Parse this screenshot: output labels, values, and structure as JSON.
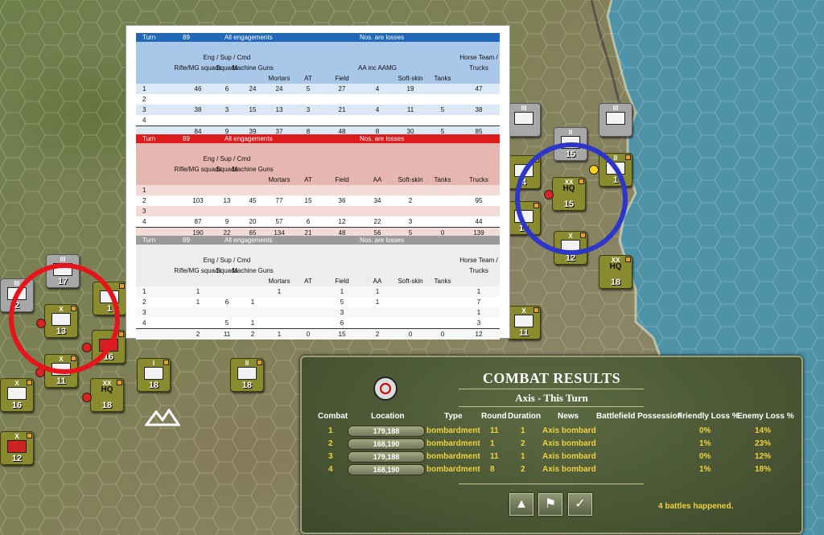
{
  "loss_tables": [
    {
      "id": "t1",
      "header": {
        "turn_label": "Turn",
        "turn": "89",
        "scope": "All engagements",
        "note": "Nos. are losses"
      },
      "columns": [
        "Rifle/MG squads",
        "Eng / Sup / Cmd Squads",
        "Machine Guns",
        "Mortars",
        "AT",
        "Field",
        "AA inc AAMG",
        "Soft-skin",
        "Tanks",
        "Horse Team / Trucks"
      ],
      "rows": [
        [
          "1",
          "46",
          "6",
          "24",
          "24",
          "5",
          "27",
          "4",
          "19",
          "",
          "47"
        ],
        [
          "2",
          "",
          "",
          "",
          "",
          "",
          "",
          "",
          "",
          "",
          ""
        ],
        [
          "3",
          "38",
          "3",
          "15",
          "13",
          "3",
          "21",
          "4",
          "11",
          "5",
          "38"
        ],
        [
          "4",
          "",
          "",
          "",
          "",
          "",
          "",
          "",
          "",
          "",
          ""
        ],
        [
          "",
          "84",
          "9",
          "39",
          "37",
          "8",
          "48",
          "8",
          "30",
          "5",
          "85"
        ]
      ]
    },
    {
      "id": "t2",
      "header": {
        "turn_label": "Turn",
        "turn": "89",
        "scope": "All engagements",
        "note": "Nos. are losses"
      },
      "columns": [
        "Rifle/MG squads",
        "Eng / Sup / Cmd Squads",
        "Machine Guns",
        "Mortars",
        "AT",
        "Field",
        "AA",
        "Soft-skin",
        "Tanks",
        "Trucks"
      ],
      "rows": [
        [
          "1",
          "",
          "",
          "",
          "",
          "",
          "",
          "",
          "",
          "",
          ""
        ],
        [
          "2",
          "103",
          "13",
          "45",
          "77",
          "15",
          "36",
          "34",
          "2",
          "",
          "95"
        ],
        [
          "3",
          "",
          "",
          "",
          "",
          "",
          "",
          "",
          "",
          "",
          ""
        ],
        [
          "4",
          "87",
          "9",
          "20",
          "57",
          "6",
          "12",
          "22",
          "3",
          "",
          "44"
        ],
        [
          "",
          "190",
          "22",
          "65",
          "134",
          "21",
          "48",
          "56",
          "5",
          "0",
          "139"
        ]
      ]
    },
    {
      "id": "t3",
      "header": {
        "turn_label": "Turn",
        "turn": "89",
        "scope": "All engagements",
        "note": "Nos. are losses"
      },
      "columns": [
        "Rifle/MG squads",
        "Eng / Sup / Cmd Squads",
        "Machine Guns",
        "Mortars",
        "AT",
        "Field",
        "AA",
        "Soft-skin",
        "Tanks",
        "Horse Team / Trucks"
      ],
      "rows": [
        [
          "1",
          "1",
          "",
          "",
          "1",
          "",
          "1",
          "1",
          "",
          "",
          "1"
        ],
        [
          "2",
          "1",
          "6",
          "1",
          "",
          "",
          "5",
          "1",
          "",
          "",
          "7"
        ],
        [
          "3",
          "",
          "",
          "",
          "",
          "",
          "3",
          "",
          "",
          "",
          "1"
        ],
        [
          "4",
          "",
          "5",
          "1",
          "",
          "",
          "6",
          "",
          "",
          "",
          "3"
        ],
        [
          "",
          "2",
          "11",
          "2",
          "1",
          "0",
          "15",
          "2",
          "0",
          "0",
          "12"
        ]
      ]
    }
  ],
  "combat_results": {
    "title": "COMBAT RESULTS",
    "subtitle": "Axis - This Turn",
    "headers": {
      "combat": "Combat",
      "location": "Location",
      "type": "Type",
      "round": "Round",
      "duration": "Duration",
      "news": "News",
      "possession": "Battlefield Possession",
      "friendly": "Friendly Loss %",
      "enemy": "Enemy Loss %"
    },
    "rows": [
      {
        "combat": "1",
        "location": "179,188",
        "type": "bombardment",
        "round": "11",
        "duration": "1",
        "news": "Axis bombard",
        "possession": "",
        "friendly": "0%",
        "enemy": "14%"
      },
      {
        "combat": "2",
        "location": "168,190",
        "type": "bombardment",
        "round": "1",
        "duration": "2",
        "news": "Axis bombard",
        "possession": "",
        "friendly": "1%",
        "enemy": "23%"
      },
      {
        "combat": "3",
        "location": "179,188",
        "type": "bombardment",
        "round": "11",
        "duration": "1",
        "news": "Axis bombard",
        "possession": "",
        "friendly": "0%",
        "enemy": "12%"
      },
      {
        "combat": "4",
        "location": "168,190",
        "type": "bombardment",
        "round": "8",
        "duration": "2",
        "news": "Axis bombard",
        "possession": "",
        "friendly": "1%",
        "enemy": "18%"
      }
    ],
    "summary": "4 battles happened.",
    "buttons": {
      "up": "▲",
      "flag": "⚑",
      "ok": "✓"
    }
  },
  "units": [
    {
      "name": "unit-iii-17",
      "size": "III",
      "number": "17",
      "kind": "gry"
    },
    {
      "name": "unit-iii-2",
      "size": "III",
      "number": "2",
      "kind": "gry"
    },
    {
      "name": "unit-x-13",
      "size": "X",
      "number": "13",
      "kind": "ger"
    },
    {
      "name": "unit-1",
      "size": "",
      "number": "1",
      "kind": "ger"
    },
    {
      "name": "unit-16",
      "size": "",
      "number": "16",
      "kind": "ger"
    },
    {
      "name": "unit-x-11-west",
      "size": "X",
      "number": "11",
      "kind": "ger"
    },
    {
      "name": "unit-i-18",
      "size": "I",
      "number": "18",
      "kind": "ger"
    },
    {
      "name": "unit-ii-18",
      "size": "II",
      "number": "18",
      "kind": "ger"
    },
    {
      "name": "unit-xx-hq-18-west",
      "size": "XX",
      "number": "18",
      "kind": "ger"
    },
    {
      "name": "unit-x-16",
      "size": "X",
      "number": "16",
      "kind": "ger"
    },
    {
      "name": "unit-x-12-west",
      "size": "X",
      "number": "12",
      "kind": "ger"
    },
    {
      "name": "unit-iii-gry-east",
      "size": "III",
      "number": "",
      "kind": "gry"
    },
    {
      "name": "unit-iii-gry-coast",
      "size": "III",
      "number": "",
      "kind": "gry"
    },
    {
      "name": "unit-ii-15",
      "size": "II",
      "number": "15",
      "kind": "gry"
    },
    {
      "name": "unit-4",
      "size": "",
      "number": "4",
      "kind": "ger"
    },
    {
      "name": "unit-xx-hq-15",
      "size": "XX",
      "number": "15",
      "kind": "ger"
    },
    {
      "name": "unit-ii-1",
      "size": "II",
      "number": "1",
      "kind": "ger"
    },
    {
      "name": "unit-14",
      "size": "",
      "number": "14",
      "kind": "ger"
    },
    {
      "name": "unit-x-12-east",
      "size": "X",
      "number": "12",
      "kind": "ger"
    },
    {
      "name": "unit-xx-hq-18-east",
      "size": "XX",
      "number": "18",
      "kind": "ger"
    },
    {
      "name": "unit-x-11-east",
      "size": "X",
      "number": "11",
      "kind": "ger"
    }
  ],
  "hq_label": "HQ",
  "colors": {
    "ring_red": "#e8141c",
    "ring_blue": "#2e36c8",
    "sea": "#4f93a9"
  }
}
